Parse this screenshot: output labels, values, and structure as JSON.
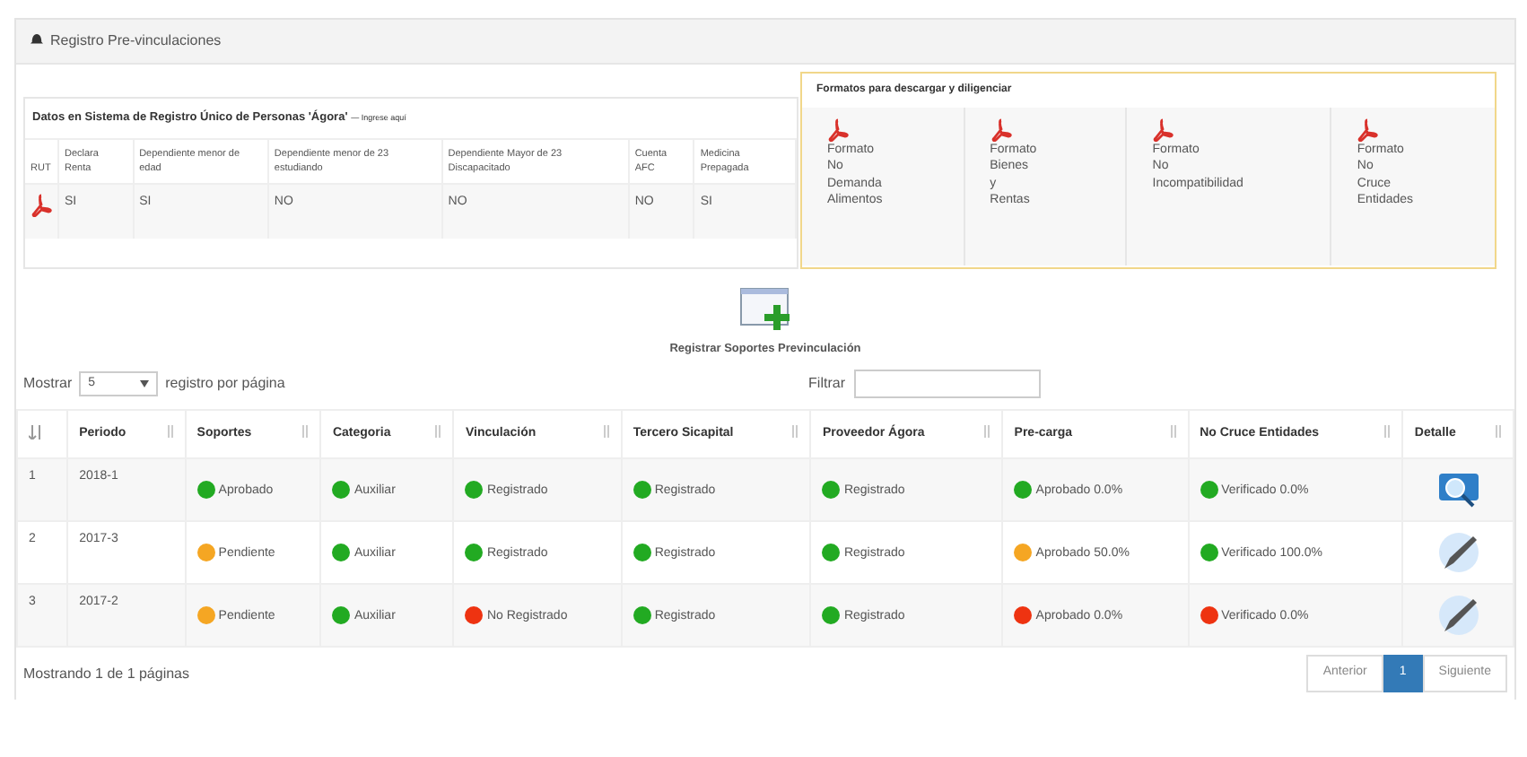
{
  "panel": {
    "title": "Registro Pre-vinculaciones"
  },
  "agora": {
    "title": "Datos en Sistema de Registro Único de Personas 'Ágora'",
    "note": "— Ingrese aquí",
    "columns": [
      "RUT",
      "Declara Renta",
      "Dependiente menor de edad",
      "Dependiente menor de 23 estudiando",
      "Dependiente Mayor de 23 Discapacitado",
      "Cuenta AFC",
      "Medicina Prepagada"
    ],
    "values": [
      "SI",
      "SI",
      "NO",
      "NO",
      "NO",
      "SI"
    ]
  },
  "formats": {
    "title": "Formatos para descargar y diligenciar",
    "items": [
      {
        "words": [
          "Formato",
          "No",
          "Demanda",
          "Alimentos"
        ]
      },
      {
        "words": [
          "Formato",
          "Bienes",
          "y",
          "Rentas"
        ]
      },
      {
        "words": [
          "Formato",
          "No",
          "Incompatibilidad"
        ]
      },
      {
        "words": [
          "Formato",
          "No",
          "Cruce",
          "Entidades"
        ]
      }
    ]
  },
  "register": {
    "label": "Registrar Soportes Previnculación"
  },
  "length": {
    "prefix": "Mostrar",
    "value": "5",
    "suffix": "registro por página"
  },
  "filter": {
    "label": "Filtrar"
  },
  "table": {
    "columns": [
      "",
      "Periodo",
      "Soportes",
      "Categoria",
      "Vinculación",
      "Tercero Sicapital",
      "Proveedor Ágora",
      "Pre-carga",
      "No Cruce Entidades",
      "Detalle"
    ],
    "rows": [
      {
        "cells": [
          {
            "kind": "text",
            "text": "1"
          },
          {
            "kind": "text",
            "text": "2018-1"
          },
          {
            "kind": "status",
            "text": "Aprobado",
            "color": "#22aa22"
          },
          {
            "kind": "status",
            "text": "Auxiliar",
            "color": "#22aa22"
          },
          {
            "kind": "status",
            "text": "Registrado",
            "color": "#22aa22"
          },
          {
            "kind": "status",
            "text": "Registrado",
            "color": "#22aa22"
          },
          {
            "kind": "status",
            "text": "Registrado",
            "color": "#22aa22"
          },
          {
            "kind": "status",
            "text": "Aprobado 0.0%",
            "color": "#22aa22"
          },
          {
            "kind": "status",
            "text": "Verificado 0.0%",
            "color": "#22aa22"
          },
          {
            "kind": "view"
          }
        ]
      },
      {
        "cells": [
          {
            "kind": "text",
            "text": "2"
          },
          {
            "kind": "text",
            "text": "2017-3"
          },
          {
            "kind": "status",
            "text": "Pendiente",
            "color": "#f5a623"
          },
          {
            "kind": "status",
            "text": "Auxiliar",
            "color": "#22aa22"
          },
          {
            "kind": "status",
            "text": "Registrado",
            "color": "#22aa22"
          },
          {
            "kind": "status",
            "text": "Registrado",
            "color": "#22aa22"
          },
          {
            "kind": "status",
            "text": "Registrado",
            "color": "#22aa22"
          },
          {
            "kind": "status",
            "text": "Aprobado 50.0%",
            "color": "#f5a623"
          },
          {
            "kind": "status",
            "text": "Verificado 100.0%",
            "color": "#22aa22"
          },
          {
            "kind": "edit"
          }
        ]
      },
      {
        "cells": [
          {
            "kind": "text",
            "text": "3"
          },
          {
            "kind": "text",
            "text": "2017-2"
          },
          {
            "kind": "status",
            "text": "Pendiente",
            "color": "#f5a623"
          },
          {
            "kind": "status",
            "text": "Auxiliar",
            "color": "#22aa22"
          },
          {
            "kind": "status",
            "text": "No Registrado",
            "color": "#ee3311"
          },
          {
            "kind": "status",
            "text": "Registrado",
            "color": "#22aa22"
          },
          {
            "kind": "status",
            "text": "Registrado",
            "color": "#22aa22"
          },
          {
            "kind": "status",
            "text": "Aprobado 0.0%",
            "color": "#ee3311"
          },
          {
            "kind": "status",
            "text": "Verificado 0.0%",
            "color": "#ee3311"
          },
          {
            "kind": "edit"
          }
        ]
      }
    ]
  },
  "footer": {
    "info": "Mostrando 1 de 1 páginas",
    "pages": [
      {
        "label": "Anterior",
        "selected": false
      },
      {
        "label": "1",
        "selected": true
      },
      {
        "label": "Siguiente",
        "selected": false
      }
    ]
  }
}
